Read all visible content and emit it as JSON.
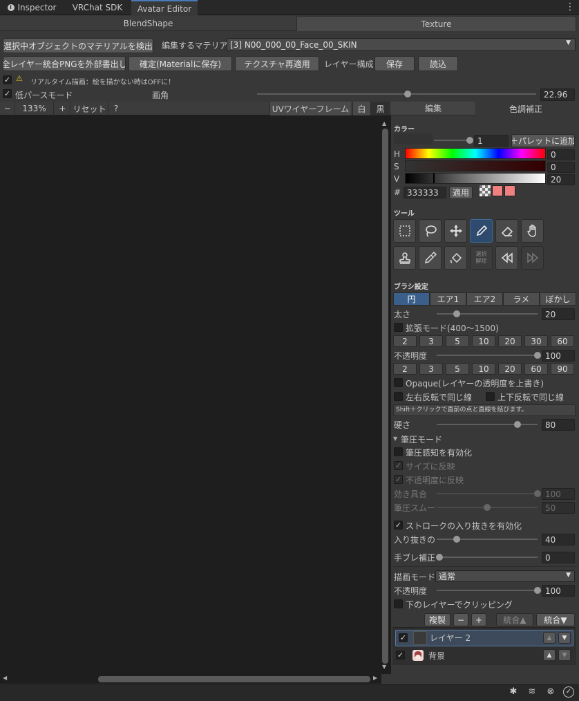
{
  "tabs": {
    "inspector": "Inspector",
    "sdk": "VRChat SDK",
    "avatar_editor": "Avatar Editor"
  },
  "mode_tabs": {
    "blendshape": "BlendShape",
    "texture": "Texture"
  },
  "toolbar": {
    "detect_material": "選択中オブジェクトのマテリアルを検出",
    "material_label": "編集するマテリアル",
    "material_value": "[3] N00_000_00_Face_00_SKIN",
    "export_png": "全レイヤー統合PNGを外部書出し",
    "apply_material": "確定(Materialに保存)",
    "reapply_texture": "テクスチャ再適用",
    "layer_config": "レイヤー構成",
    "save": "保存",
    "load": "読込",
    "realtime_warning": "リアルタイム描画：絵を描かない時はOFFに！",
    "low_perspective": "低パースモード",
    "fov_label": "画角",
    "fov_value": "22.96"
  },
  "fov": {
    "fraction": 0.54
  },
  "canvas_bar": {
    "zoom_minus": "−",
    "zoom": "133%",
    "zoom_plus": "+",
    "reset": "リセット",
    "help": "?",
    "uv_wire": "UVワイヤーフレーム",
    "white": "白",
    "black": "黒"
  },
  "panel_tabs": {
    "edit": "編集",
    "color_adjust": "色調補正"
  },
  "color": {
    "title": "カラー",
    "alpha_value": "1",
    "alpha_fraction": 1.0,
    "add_palette": "＋パレットに追加",
    "h_label": "H",
    "h_value": "0",
    "s_label": "S",
    "s_value": "0",
    "v_label": "V",
    "v_value": "20",
    "v_fraction": 0.2,
    "hash": "#",
    "hex": "333333",
    "apply": "適用",
    "current_color": "#333333",
    "palette": [
      "#f08080",
      "#f08080"
    ]
  },
  "tools": {
    "title": "ツール",
    "select_release": "選択\n解除",
    "items": [
      "rect-select",
      "lasso",
      "move",
      "pen",
      "eraser",
      "hand",
      "stamp",
      "eyedropper",
      "fill",
      "deselect",
      "undo",
      "redo"
    ]
  },
  "brush": {
    "title": "ブラシ設定",
    "types": [
      "円",
      "エア1",
      "エア2",
      "ラメ",
      "ぼかし"
    ],
    "size_label": "太さ",
    "size_value": "20",
    "size_fraction": 0.2,
    "extend_mode": "拡張モード(400〜1500)",
    "size_presets": [
      "2",
      "3",
      "5",
      "10",
      "20",
      "30",
      "60"
    ],
    "opacity_label": "不透明度",
    "opacity_value": "100",
    "opacity_fraction": 1.0,
    "opacity_presets": [
      "2",
      "3",
      "5",
      "10",
      "20",
      "60",
      "90"
    ],
    "opaque": "Opaque(レイヤーの透明度を上書き)",
    "mirror_lr": "左右反転で同じ線",
    "mirror_ud": "上下反転で同じ線",
    "shift_hint": "Shift＋クリックで直前の点と直線を結びます。",
    "hardness_label": "硬さ",
    "hardness_value": "80",
    "hardness_fraction": 0.8
  },
  "pressure": {
    "title": "筆圧モード",
    "enable": "筆圧感知を有効化",
    "size": "サイズに反映",
    "opacity": "不透明度に反映",
    "effect_label": "効き具合",
    "effect_value": "100",
    "effect_fraction": 1.0,
    "smooth_label": "筆圧スムーｼﾞ",
    "smooth_value": "50",
    "smooth_fraction": 0.5,
    "stroke_enable": "ストロークの入り抜きを有効化",
    "taper_label": "入り抜きの𧘕",
    "taper_value": "40",
    "taper_fraction": 0.2,
    "stabilizer_label": "手ブレ補正",
    "stabilizer_value": "0",
    "stabilizer_fraction": 0.0
  },
  "layer": {
    "blend_label": "描画モード",
    "blend_value": "通常",
    "opacity_label": "不透明度",
    "opacity_value": "100",
    "opacity_fraction": 1.0,
    "clip": "下のレイヤーでクリッピング",
    "duplicate": "複製",
    "remove": "−",
    "add": "+",
    "merge_up": "統合▲",
    "merge_down": "統合▼",
    "items": [
      {
        "name": "レイヤー 2"
      },
      {
        "name": "背景"
      }
    ]
  }
}
